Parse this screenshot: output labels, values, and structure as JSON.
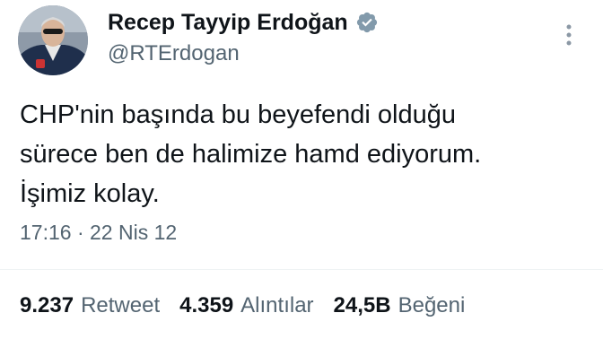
{
  "tweet": {
    "author": {
      "display_name": "Recep Tayyip Erdoğan",
      "handle": "@RTErdogan",
      "verified_icon": "verified-badge-icon",
      "verified_color": "#829aab"
    },
    "text_lines": [
      "CHP'nin başında bu beyefendi olduğu",
      "sürece ben de halimize hamd ediyorum.",
      "İşimiz kolay."
    ],
    "time": "17:16",
    "separator": "·",
    "date": "22 Nis 12",
    "stats": [
      {
        "count": "9.237",
        "label": "Retweet"
      },
      {
        "count": "4.359",
        "label": "Alıntılar"
      },
      {
        "count": "24,5B",
        "label": "Beğeni"
      }
    ],
    "more_icon": "more-vertical-icon",
    "colors": {
      "text": "#0f1419",
      "secondary": "#536471",
      "divider": "#eff3f4"
    }
  }
}
